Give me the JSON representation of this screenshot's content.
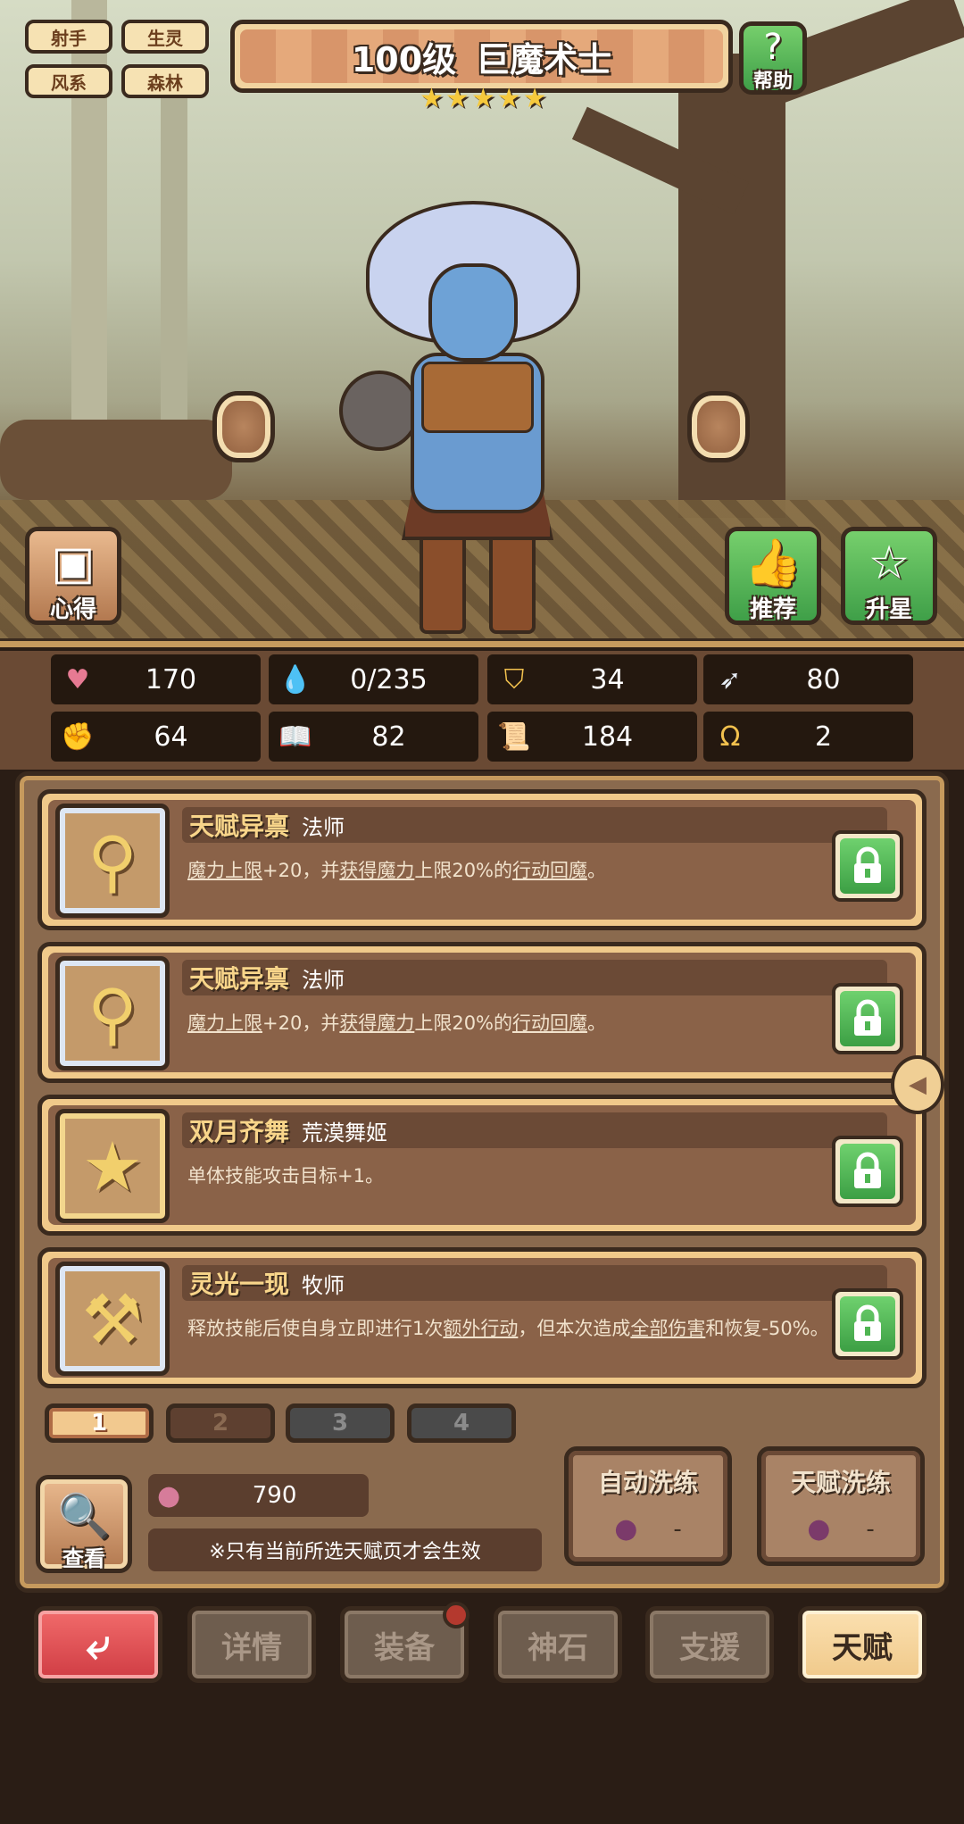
{
  "header": {
    "tags": [
      "射手",
      "生灵",
      "风系",
      "森林"
    ],
    "level": "100级",
    "hero_name": "巨魔术士",
    "stars": 5,
    "help_label": "帮助"
  },
  "side_buttons": {
    "notes_label": "心得",
    "recommend_label": "推荐",
    "star_up_label": "升星"
  },
  "stats": [
    {
      "icon": "heart-icon",
      "value": "170"
    },
    {
      "icon": "mana-drop-icon",
      "value": "0/235"
    },
    {
      "icon": "shield-icon",
      "value": "34"
    },
    {
      "icon": "wing-icon",
      "value": "80"
    },
    {
      "icon": "fist-icon",
      "value": "64"
    },
    {
      "icon": "book-icon",
      "value": "82"
    },
    {
      "icon": "scroll-icon",
      "value": "184"
    },
    {
      "icon": "horseshoe-icon",
      "value": "2"
    }
  ],
  "talents": [
    {
      "name": "天赋异禀",
      "class": "法师",
      "icon": "staff-icon",
      "desc_parts": [
        [
          "魔力上限",
          true
        ],
        [
          "+20，并",
          false
        ],
        [
          "获得魔力",
          true
        ],
        [
          "上限20%的",
          false
        ],
        [
          "行动回魔",
          true
        ],
        [
          "。",
          false
        ]
      ]
    },
    {
      "name": "天赋异禀",
      "class": "法师",
      "icon": "staff-icon",
      "desc_parts": [
        [
          "魔力上限",
          true
        ],
        [
          "+20，并",
          false
        ],
        [
          "获得魔力",
          true
        ],
        [
          "上限20%的",
          false
        ],
        [
          "行动回魔",
          true
        ],
        [
          "。",
          false
        ]
      ]
    },
    {
      "name": "双月齐舞",
      "class": "荒漠舞姬",
      "icon": "star-icon",
      "desc_parts": [
        [
          "单体技能攻击目标+1。",
          false
        ]
      ]
    },
    {
      "name": "灵光一现",
      "class": "牧师",
      "icon": "mace-icon",
      "desc_parts": [
        [
          "释放技能后使自身立即进行1次",
          false
        ],
        [
          "额外行动",
          true
        ],
        [
          "，但本次造成",
          false
        ],
        [
          "全部伤害",
          true
        ],
        [
          "和恢复-50%。",
          false
        ]
      ]
    }
  ],
  "pages": [
    "1",
    "2",
    "3",
    "4"
  ],
  "bottom_panel": {
    "view_label": "查看",
    "gem_count": "790",
    "note": "※只有当前所选天赋页才会生效",
    "auto_wash_label": "自动洗练",
    "auto_wash_value": "-",
    "talent_wash_label": "天赋洗练",
    "talent_wash_value": "-"
  },
  "nav": {
    "back_label": "⤶",
    "details_label": "详情",
    "equipment_label": "装备",
    "godstone_label": "神石",
    "support_label": "支援",
    "talent_label": "天赋"
  },
  "colors": {
    "lock_green": "#4fb552",
    "accent_gold": "#f8d58a",
    "nav_red": "#d03d44"
  }
}
